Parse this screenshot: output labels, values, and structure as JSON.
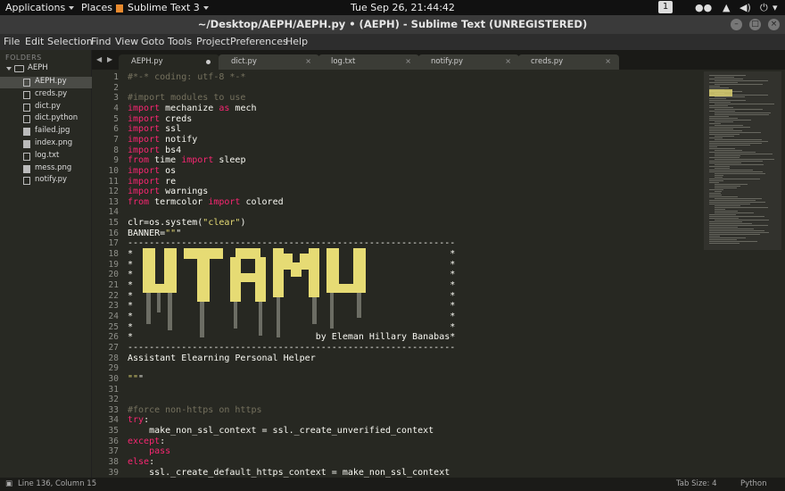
{
  "topbar": {
    "applications": "Applications",
    "places": "Places",
    "app_name": "Sublime Text 3",
    "clock": "Tue Sep 26, 21:44:42",
    "workspace": "1"
  },
  "window": {
    "title": "~/Desktop/AEPH/AEPH.py • (AEPH) - Sublime Text (UNREGISTERED)"
  },
  "menu": [
    "File",
    "Edit",
    "Selection",
    "Find",
    "View",
    "Goto",
    "Tools",
    "Project",
    "Preferences",
    "Help"
  ],
  "sidebar": {
    "header": "FOLDERS",
    "folder": "AEPH",
    "files": [
      {
        "name": "AEPH.py",
        "icon": "file-icon"
      },
      {
        "name": "creds.py",
        "icon": "file-icon"
      },
      {
        "name": "dict.py",
        "icon": "file-icon"
      },
      {
        "name": "dict.python",
        "icon": "file-icon"
      },
      {
        "name": "failed.jpg",
        "icon": "image-icon"
      },
      {
        "name": "index.png",
        "icon": "image-icon"
      },
      {
        "name": "log.txt",
        "icon": "file-icon"
      },
      {
        "name": "mess.png",
        "icon": "image-icon"
      },
      {
        "name": "notify.py",
        "icon": "file-icon"
      }
    ]
  },
  "tabs": [
    {
      "label": "AEPH.py",
      "modified": true
    },
    {
      "label": "dict.py",
      "modified": false
    },
    {
      "label": "log.txt",
      "modified": false
    },
    {
      "label": "notify.py",
      "modified": false
    },
    {
      "label": "creds.py",
      "modified": false
    }
  ],
  "editor": {
    "lines": [
      {
        "n": "1",
        "text": "#*-* coding: utf-8 *-*"
      },
      {
        "n": "2",
        "text": ""
      },
      {
        "n": "3",
        "text": "#import modules to use"
      },
      {
        "n": "4",
        "text": "import mechanize as mech"
      },
      {
        "n": "5",
        "text": "import creds"
      },
      {
        "n": "6",
        "text": "import ssl"
      },
      {
        "n": "7",
        "text": "import notify"
      },
      {
        "n": "8",
        "text": "import bs4"
      },
      {
        "n": "9",
        "text": "from time import sleep"
      },
      {
        "n": "10",
        "text": "import os"
      },
      {
        "n": "11",
        "text": "import re"
      },
      {
        "n": "12",
        "text": "import warnings"
      },
      {
        "n": "13",
        "text": "from termcolor import colored"
      },
      {
        "n": "14",
        "text": ""
      },
      {
        "n": "15",
        "text": "clr=os.system(\"clear\")"
      },
      {
        "n": "16",
        "text": "BANNER=\"\"\""
      },
      {
        "n": "17",
        "text": "-------------------------------------------------------------"
      },
      {
        "n": "18",
        "text": "*                                                           *"
      },
      {
        "n": "19",
        "text": "*                                                           *"
      },
      {
        "n": "20",
        "text": "*                                                           *"
      },
      {
        "n": "21",
        "text": "*                                                           *"
      },
      {
        "n": "22",
        "text": "*                                                           *"
      },
      {
        "n": "23",
        "text": "*                                                           *"
      },
      {
        "n": "24",
        "text": "*                                                           *"
      },
      {
        "n": "25",
        "text": "*                                                           *"
      },
      {
        "n": "26",
        "text": "*                                  by Eleman Hillary Banabas*"
      },
      {
        "n": "27",
        "text": "-------------------------------------------------------------"
      },
      {
        "n": "28",
        "text": "Assistant Elearning Personal Helper"
      },
      {
        "n": "29",
        "text": ""
      },
      {
        "n": "30",
        "text": "\"\"\""
      },
      {
        "n": "31",
        "text": ""
      },
      {
        "n": "32",
        "text": ""
      },
      {
        "n": "33",
        "text": "#force non-https on https"
      },
      {
        "n": "34",
        "text": "try:"
      },
      {
        "n": "35",
        "text": "    make_non_ssl_context = ssl._create_unverified_context"
      },
      {
        "n": "36",
        "text": "except:"
      },
      {
        "n": "37",
        "text": "    pass"
      },
      {
        "n": "38",
        "text": "else:"
      },
      {
        "n": "39",
        "text": "    ssl._create_default_https_context = make_non_ssl_context"
      }
    ],
    "banner_art_text": "UTAMU",
    "banner_color": "#e6db74"
  },
  "status": {
    "position": "Line 136, Column 15",
    "tab_size": "Tab Size: 4",
    "syntax": "Python"
  },
  "colors": {
    "background": "#272822",
    "keyword": "#f92672",
    "comment": "#75715e",
    "string": "#e6db74"
  }
}
